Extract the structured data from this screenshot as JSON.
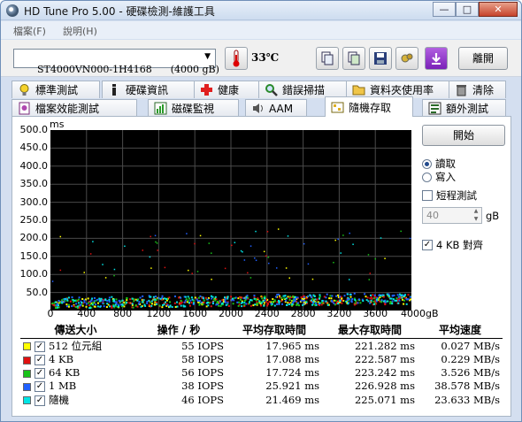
{
  "window": {
    "title": "HD Tune Pro  5.00 - 硬碟檢測-維護工具",
    "min": "—",
    "max": "□",
    "close": "✕"
  },
  "menu": [
    {
      "label": "檔案(F)"
    },
    {
      "label": "說明(H)"
    }
  ],
  "toolbar": {
    "drive": "ST4000VN000-1H4168      (4000 gB)",
    "temperature": "33℃",
    "exit_label": "離開",
    "icons": [
      "thermometer-icon",
      "copy-icon",
      "copy-all-icon",
      "save-icon",
      "screenshot-icon",
      "download-icon"
    ]
  },
  "tabs_row1": [
    {
      "label": "標準測試",
      "icon": "bulb-icon"
    },
    {
      "label": "硬碟資訊",
      "icon": "info-icon"
    },
    {
      "label": "健康",
      "icon": "health-cross-icon"
    },
    {
      "label": "錯誤掃描",
      "icon": "magnifier-icon"
    },
    {
      "label": "資料夾使用率",
      "icon": "folder-icon"
    },
    {
      "label": "清除",
      "icon": "trash-icon"
    }
  ],
  "tabs_row2": [
    {
      "label": "檔案效能測試",
      "icon": "file-bench-icon"
    },
    {
      "label": "磁碟監視",
      "icon": "monitor-icon"
    },
    {
      "label": "AAM",
      "icon": "speaker-icon"
    },
    {
      "label": "隨機存取",
      "icon": "random-access-icon",
      "active": true
    },
    {
      "label": "額外測試",
      "icon": "extra-test-icon"
    }
  ],
  "controls": {
    "start_label": "開始",
    "read_label": "讀取",
    "write_label": "寫入",
    "mode": "read",
    "short_test_label": "短程測試",
    "short_test_checked": false,
    "short_value": "40",
    "short_unit": "gB",
    "align_label": "4 KB 對齊",
    "align_checked": true
  },
  "chart_data": {
    "type": "scatter",
    "ylabel": "ms",
    "xlabel": "gB",
    "xlim": [
      0,
      4000
    ],
    "ylim": [
      0,
      500
    ],
    "x_ticks": [
      "0",
      "400",
      "800",
      "1200",
      "1600",
      "2000",
      "2400",
      "2800",
      "3200",
      "3600",
      "4000gB"
    ],
    "y_ticks": [
      "500.0",
      "450.0",
      "400.0",
      "350.0",
      "300.0",
      "250.0",
      "200.0",
      "150.0",
      "100.0",
      "50.0"
    ],
    "grid": true,
    "series": [
      {
        "name": "512 位元組",
        "color": "#ffff00",
        "band": [
          8,
          35
        ]
      },
      {
        "name": "4 KB",
        "color": "#e01010",
        "band": [
          8,
          35
        ]
      },
      {
        "name": "64 KB",
        "color": "#19c319",
        "band": [
          8,
          35
        ]
      },
      {
        "name": "1 MB",
        "color": "#2060ff",
        "band": [
          12,
          40
        ]
      },
      {
        "name": "隨機",
        "color": "#00e5e5",
        "band": [
          8,
          38
        ]
      }
    ]
  },
  "results": {
    "headers": [
      "傳送大小",
      "操作 / 秒",
      "平均存取時間",
      "最大存取時間",
      "平均速度"
    ],
    "rows": [
      {
        "size": "512 位元組",
        "color": "#ffff00",
        "ops": "55 IOPS",
        "avg": "17.965 ms",
        "max": "221.282 ms",
        "speed": "0.027 MB/s"
      },
      {
        "size": "4 KB",
        "color": "#e01010",
        "ops": "58 IOPS",
        "avg": "17.088 ms",
        "max": "222.587 ms",
        "speed": "0.229 MB/s"
      },
      {
        "size": "64 KB",
        "color": "#19c319",
        "ops": "56 IOPS",
        "avg": "17.724 ms",
        "max": "223.242 ms",
        "speed": "3.526 MB/s"
      },
      {
        "size": "1 MB",
        "color": "#2060ff",
        "ops": "38 IOPS",
        "avg": "25.921 ms",
        "max": "226.928 ms",
        "speed": "38.578 MB/s"
      },
      {
        "size": "隨機",
        "color": "#00e5e5",
        "ops": "46 IOPS",
        "avg": "21.469 ms",
        "max": "225.071 ms",
        "speed": "23.633 MB/s"
      }
    ]
  }
}
